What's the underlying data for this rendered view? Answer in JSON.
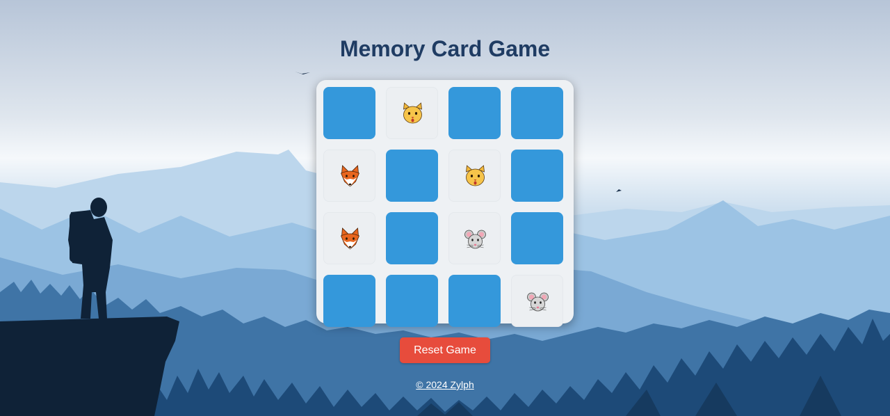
{
  "title": "Memory Card Game",
  "reset_label": "Reset Game",
  "footer_text": "© 2024 Zylph",
  "colors": {
    "card_back": "#3498db",
    "card_face": "#eceff2",
    "reset_button": "#e74c3c",
    "title": "#1f3c63"
  },
  "board": {
    "rows": 4,
    "cols": 4,
    "cards": [
      {
        "state": "hidden",
        "icon": ""
      },
      {
        "state": "revealed",
        "icon": "cat-face-icon"
      },
      {
        "state": "hidden",
        "icon": ""
      },
      {
        "state": "hidden",
        "icon": ""
      },
      {
        "state": "revealed",
        "icon": "fox-face-icon"
      },
      {
        "state": "hidden",
        "icon": ""
      },
      {
        "state": "revealed",
        "icon": "cat-face-icon"
      },
      {
        "state": "hidden",
        "icon": ""
      },
      {
        "state": "revealed",
        "icon": "fox-face-icon"
      },
      {
        "state": "hidden",
        "icon": ""
      },
      {
        "state": "revealed",
        "icon": "mouse-face-icon"
      },
      {
        "state": "hidden",
        "icon": ""
      },
      {
        "state": "hidden",
        "icon": ""
      },
      {
        "state": "hidden",
        "icon": ""
      },
      {
        "state": "hidden",
        "icon": ""
      },
      {
        "state": "revealed",
        "icon": "mouse-face-icon"
      }
    ]
  }
}
